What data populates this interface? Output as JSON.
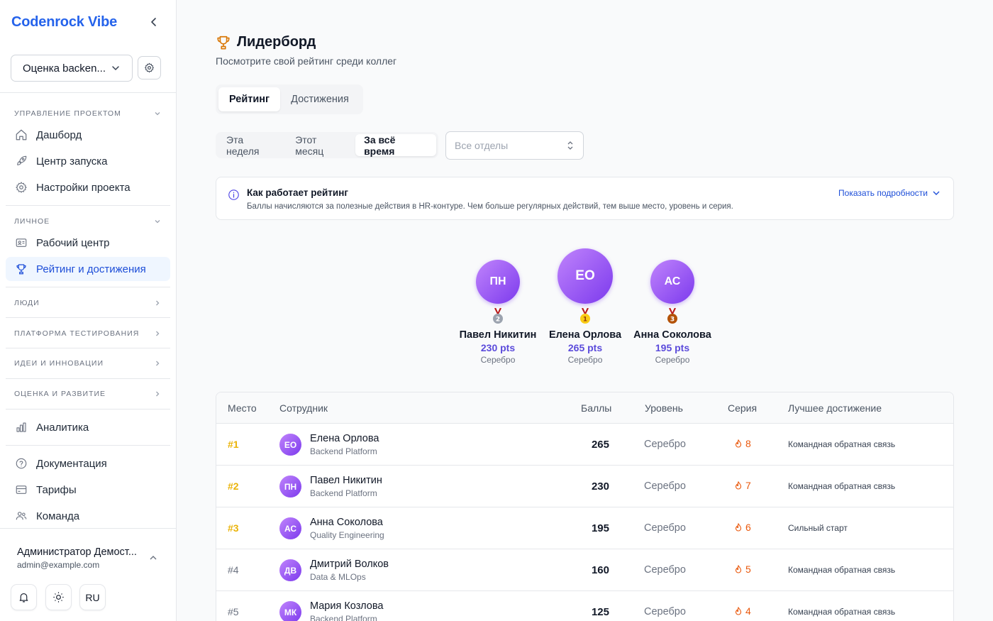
{
  "sidebar": {
    "brand": "Codenrock Vibe",
    "project_select": "Оценка backen...",
    "sections": {
      "project_mgmt": "Управление проектом",
      "personal": "Личное",
      "people": "Люди",
      "testing": "Платформа тестирования",
      "ideas": "Идеи и инновации",
      "evaluation": "Оценка и развитие"
    },
    "items": {
      "dashboard": "Дашборд",
      "launch_center": "Центр запуска",
      "project_settings": "Настройки проекта",
      "work_center": "Рабочий центр",
      "rating": "Рейтинг и достижения",
      "analytics": "Аналитика",
      "docs": "Документация",
      "tariffs": "Тарифы",
      "team": "Команда"
    },
    "user": {
      "name": "Администратор Демост...",
      "email": "admin@example.com"
    },
    "lang": "RU"
  },
  "main": {
    "title": "Лидерборд",
    "subtitle": "Посмотрите свой рейтинг среди коллег",
    "tabs": [
      "Рейтинг",
      "Достижения"
    ],
    "periods": [
      "Эта неделя",
      "Этот месяц",
      "За всё время"
    ],
    "dept_placeholder": "Все отделы",
    "info": {
      "title": "Как работает рейтинг",
      "text": "Баллы начисляются за полезные действия в HR-контуре. Чем больше регулярных действий, тем выше место, уровень и серия.",
      "link": "Показать подробности"
    },
    "podium": [
      {
        "initials": "ПН",
        "name": "Павел Никитин",
        "pts": "230 pts",
        "level": "Серебро",
        "medal": "2"
      },
      {
        "initials": "ЕО",
        "name": "Елена Орлова",
        "pts": "265 pts",
        "level": "Серебро",
        "medal": "1"
      },
      {
        "initials": "АС",
        "name": "Анна Соколова",
        "pts": "195 pts",
        "level": "Серебро",
        "medal": "3"
      }
    ],
    "table": {
      "headers": [
        "Место",
        "Сотрудник",
        "Баллы",
        "Уровень",
        "Серия",
        "Лучшее достижение"
      ],
      "rows": [
        {
          "rank": "#1",
          "initials": "ЕО",
          "name": "Елена Орлова",
          "dept": "Backend Platform",
          "points": "265",
          "level": "Серебро",
          "streak": "8",
          "achievement": "Командная обратная связь"
        },
        {
          "rank": "#2",
          "initials": "ПН",
          "name": "Павел Никитин",
          "dept": "Backend Platform",
          "points": "230",
          "level": "Серебро",
          "streak": "7",
          "achievement": "Командная обратная связь"
        },
        {
          "rank": "#3",
          "initials": "АС",
          "name": "Анна Соколова",
          "dept": "Quality Engineering",
          "points": "195",
          "level": "Серебро",
          "streak": "6",
          "achievement": "Сильный старт"
        },
        {
          "rank": "#4",
          "initials": "ДВ",
          "name": "Дмитрий Волков",
          "dept": "Data & MLOps",
          "points": "160",
          "level": "Серебро",
          "streak": "5",
          "achievement": "Командная обратная связь"
        },
        {
          "rank": "#5",
          "initials": "МК",
          "name": "Мария Козлова",
          "dept": "Backend Platform",
          "points": "125",
          "level": "Серебро",
          "streak": "4",
          "achievement": "Командная обратная связь"
        }
      ]
    }
  },
  "colors": {
    "brand": "#2563eb",
    "accent_points": "#5b4bdb",
    "top_rank": "#eab308",
    "streak": "#ea580c",
    "avatar_gradient": [
      "#c084fc",
      "#7c3aed"
    ]
  }
}
